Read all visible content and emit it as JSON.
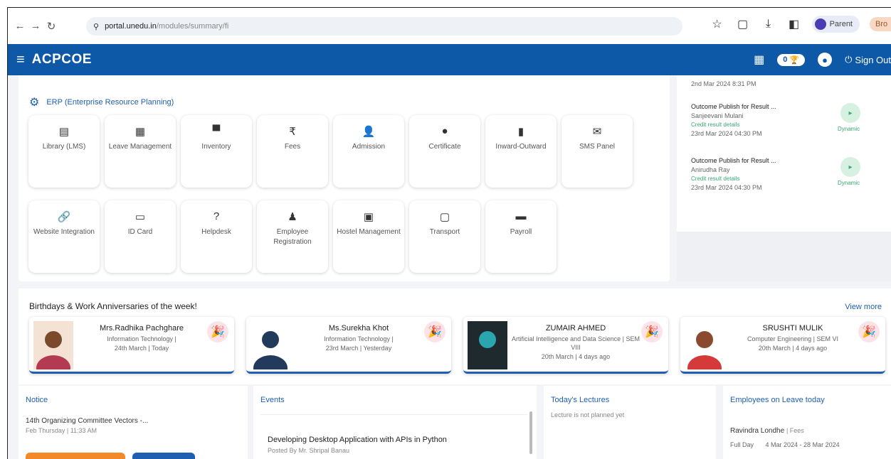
{
  "browser": {
    "url_host": "portal.unedu.in",
    "url_path": "/modules/summary/fi",
    "profile_label": "Parent",
    "profile2_label": "Bro"
  },
  "header": {
    "title": "ACPCOE",
    "notif_count": "0",
    "signout_label": "Sign Out"
  },
  "erp": {
    "title": "ERP (Enterprise Resource Planning)",
    "tiles": [
      {
        "icon": "▤",
        "label": "Library (LMS)"
      },
      {
        "icon": "▦",
        "label": "Leave Management"
      },
      {
        "icon": "▀",
        "label": "Inventory"
      },
      {
        "icon": "₹",
        "label": "Fees"
      },
      {
        "icon": "👤",
        "label": "Admission"
      },
      {
        "icon": "●",
        "label": "Certificate"
      },
      {
        "icon": "▮",
        "label": "Inward-Outward"
      },
      {
        "icon": "✉",
        "label": "SMS Panel"
      },
      {
        "icon": "🔗",
        "label": "Website Integration"
      },
      {
        "icon": "▭",
        "label": "ID Card"
      },
      {
        "icon": "?",
        "label": "Helpdesk"
      },
      {
        "icon": "♟",
        "label": "Employee Registration"
      },
      {
        "icon": "▣",
        "label": "Hostel Management"
      },
      {
        "icon": "▢",
        "label": "Transport"
      },
      {
        "icon": "▬",
        "label": "Payroll"
      }
    ]
  },
  "rightcol": {
    "date0": "2nd Mar 2024 8:31 PM",
    "items": [
      {
        "title": "Outcome Publish for Result ...",
        "name": "Sanjeevani Mulani",
        "sub": "Credit result details",
        "date": "23rd Mar 2024 04:30 PM",
        "badge": "▸",
        "tag": "Dynamic"
      },
      {
        "title": "Outcome Publish for Result ...",
        "name": "Anirudha Ray",
        "sub": "Credit result details",
        "date": "23rd Mar 2024 04:30 PM",
        "badge": "▸",
        "tag": "Dynamic"
      }
    ]
  },
  "birthdays": {
    "title": "Birthdays & Work Anniversaries of the week!",
    "view_more": "View more",
    "people": [
      {
        "name": "Mrs.Radhika Pachghare",
        "dept": "Information Technology |",
        "date": "24th March | Today",
        "bg": "#f4e3d4",
        "face": "#7a4a2a",
        "cloth": "#b23a52"
      },
      {
        "name": "Ms.Surekha Khot",
        "dept": "Information Technology |",
        "date": "23rd March | Yesterday",
        "bg": "#ffffff",
        "face": "#223a5c",
        "cloth": "#223a5c"
      },
      {
        "name": "ZUMAIR AHMED",
        "dept": "Artificial Intelligence and Data Science | SEM VIII",
        "date": "20th March | 4 days ago",
        "bg": "#1e2a2e",
        "face": "#2aa6b0",
        "cloth": "#1e2a2e"
      },
      {
        "name": "SRUSHTI MULIK",
        "dept": "Computer Engineering | SEM VI",
        "date": "20th March | 4 days ago",
        "bg": "#ffffff",
        "face": "#8a4a2e",
        "cloth": "#d43a3a"
      }
    ]
  },
  "notice": {
    "title": "Notice",
    "text": "14th  Organizing Committee Vectors -...",
    "sub": "Feb  Thursday | 11:33 AM"
  },
  "events": {
    "title": "Events",
    "item_title": "Developing Desktop Application with APIs in Python",
    "item_sub": "Posted By Mr. Shripal Banau"
  },
  "lectures": {
    "title": "Today's Lectures",
    "sub": "Lecture is not planned yet"
  },
  "leave": {
    "title": "Employees on Leave today",
    "name": "Ravindra Londhe",
    "tag": "| Fees",
    "type": "Full Day",
    "range": "4 Mar 2024 - 28 Mar 2024"
  }
}
